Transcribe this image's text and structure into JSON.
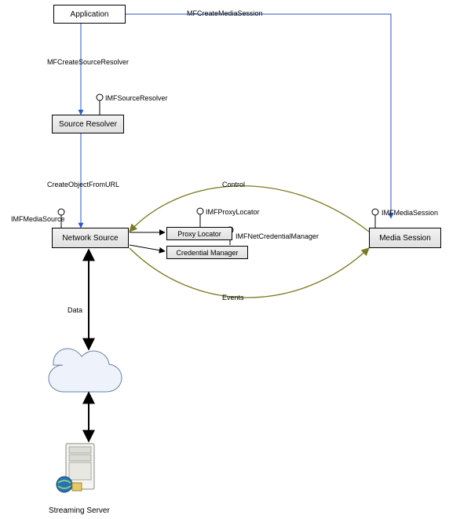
{
  "nodes": {
    "application": "Application",
    "source_resolver": "Source Resolver",
    "network_source": "Network Source",
    "proxy_locator": "Proxy Locator",
    "credential_manager": "Credential Manager",
    "media_session": "Media Session",
    "streaming_server": "Streaming Server"
  },
  "labels": {
    "mfcreate_media_session": "MFCreateMediaSession",
    "mfcreate_source_resolver": "MFCreateSourceResolver",
    "imf_source_resolver": "IMFSourceResolver",
    "create_object_from_url": "CreateObjectFromURL",
    "imf_media_source": "IMFMediaSource",
    "imf_proxy_locator": "IMFProxyLocator",
    "imf_net_credential_manager": "IMFNetCredentialManager",
    "imf_media_session": "IMFMediaSession",
    "control": "Control",
    "events": "Events",
    "data": "Data"
  }
}
